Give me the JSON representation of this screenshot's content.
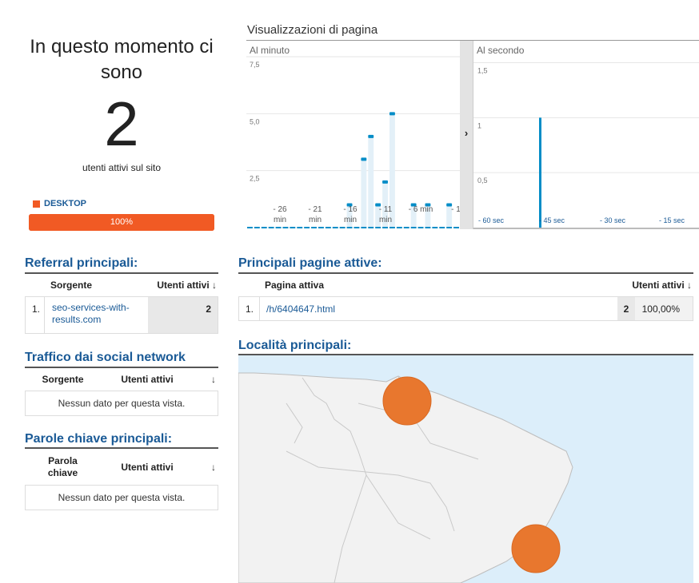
{
  "summary": {
    "title": "In questo momento ci sono",
    "count": "2",
    "subtitle": "utenti attivi sul sito"
  },
  "device": {
    "label": "DESKTOP",
    "percent_label": "100%",
    "fraction": 1.0,
    "color": "#f15a24"
  },
  "pageviews": {
    "title": "Visualizzazioni di pagina",
    "per_minute_label": "Al minuto",
    "per_second_label": "Al secondo",
    "toggle_icon": "chevron-right-icon"
  },
  "chart_data": [
    {
      "type": "bar",
      "title": "Al minuto",
      "y_ticks": [
        "7,5",
        "5,0",
        "2,5"
      ],
      "ylim": [
        0,
        7.5
      ],
      "x_ticks": [
        "- 26 min",
        "- 21 min",
        "- 16 min",
        "- 11 min",
        "- 6 min",
        "- 1"
      ],
      "values": [
        0,
        0,
        0,
        0,
        0,
        0,
        0,
        0,
        0,
        0,
        0,
        0,
        0,
        0,
        1,
        0,
        3,
        4,
        1,
        2,
        5,
        0,
        0,
        1,
        0,
        1,
        0,
        0,
        1,
        0
      ],
      "color": "#058dc7"
    },
    {
      "type": "bar",
      "title": "Al secondo",
      "y_ticks": [
        "1,5",
        "1",
        "0,5"
      ],
      "ylim": [
        0,
        1.7
      ],
      "x_ticks": [
        "- 60 sec",
        "- 45 sec",
        "- 30 sec",
        "- 15 sec"
      ],
      "spike_seconds_ago": 45,
      "spike_value": 1,
      "color": "#058dc7"
    }
  ],
  "referral": {
    "heading": "Referral principali:",
    "col_source": "Sorgente",
    "col_users": "Utenti attivi",
    "rows": [
      {
        "index": "1.",
        "source": "seo-services-with-results.com",
        "users": "2"
      }
    ]
  },
  "social": {
    "heading": "Traffico dai social network",
    "col_source": "Sorgente",
    "col_users": "Utenti attivi",
    "empty": "Nessun dato per questa vista."
  },
  "keywords": {
    "heading": "Parole chiave principali:",
    "col_keyword": "Parola chiave",
    "col_users": "Utenti attivi",
    "empty": "Nessun dato per questa vista."
  },
  "pages": {
    "heading": "Principali pagine attive:",
    "col_page": "Pagina attiva",
    "col_users": "Utenti attivi",
    "rows": [
      {
        "index": "1.",
        "page": "/h/6404647.html",
        "users": "2",
        "percent": "100,00%"
      }
    ]
  },
  "locations": {
    "heading": "Località principali:",
    "marker_color": "#e8772e",
    "sea_color": "#dceefa",
    "land_color": "#f2f2f2"
  }
}
